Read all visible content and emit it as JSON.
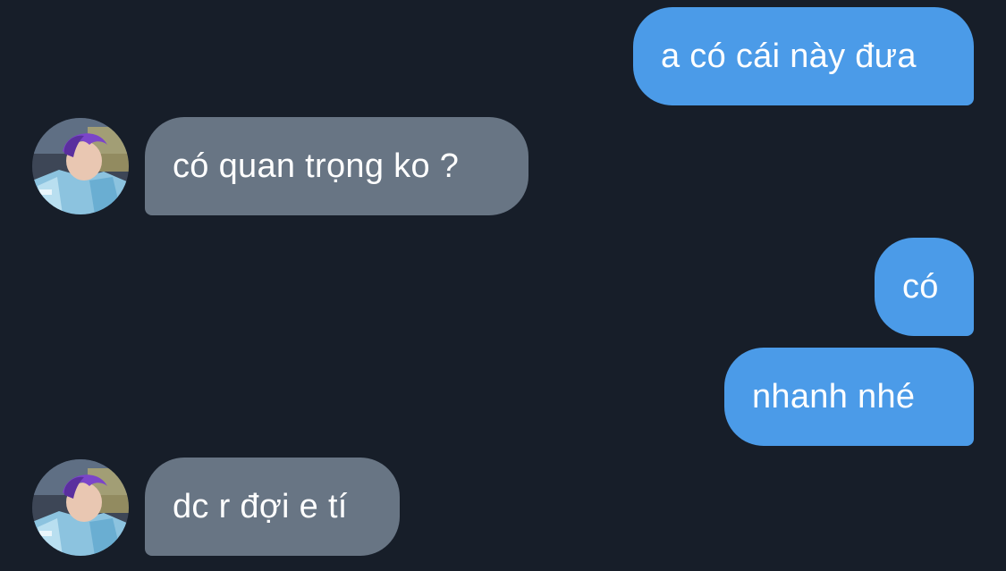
{
  "messages": [
    {
      "id": "m1",
      "direction": "sent",
      "text": "a có cái này đưa"
    },
    {
      "id": "m2",
      "direction": "received",
      "text": "có quan trọng ko ?"
    },
    {
      "id": "m3",
      "direction": "sent",
      "text": "có"
    },
    {
      "id": "m4",
      "direction": "sent",
      "text": "nhanh nhé"
    },
    {
      "id": "m5",
      "direction": "received",
      "text": "dc r đợi e tí"
    }
  ],
  "colors": {
    "background": "#171e29",
    "sent_bubble": "#4b9be8",
    "received_bubble": "#687584",
    "text": "#ffffff"
  },
  "avatar": {
    "icon": "contact-avatar-photo"
  }
}
